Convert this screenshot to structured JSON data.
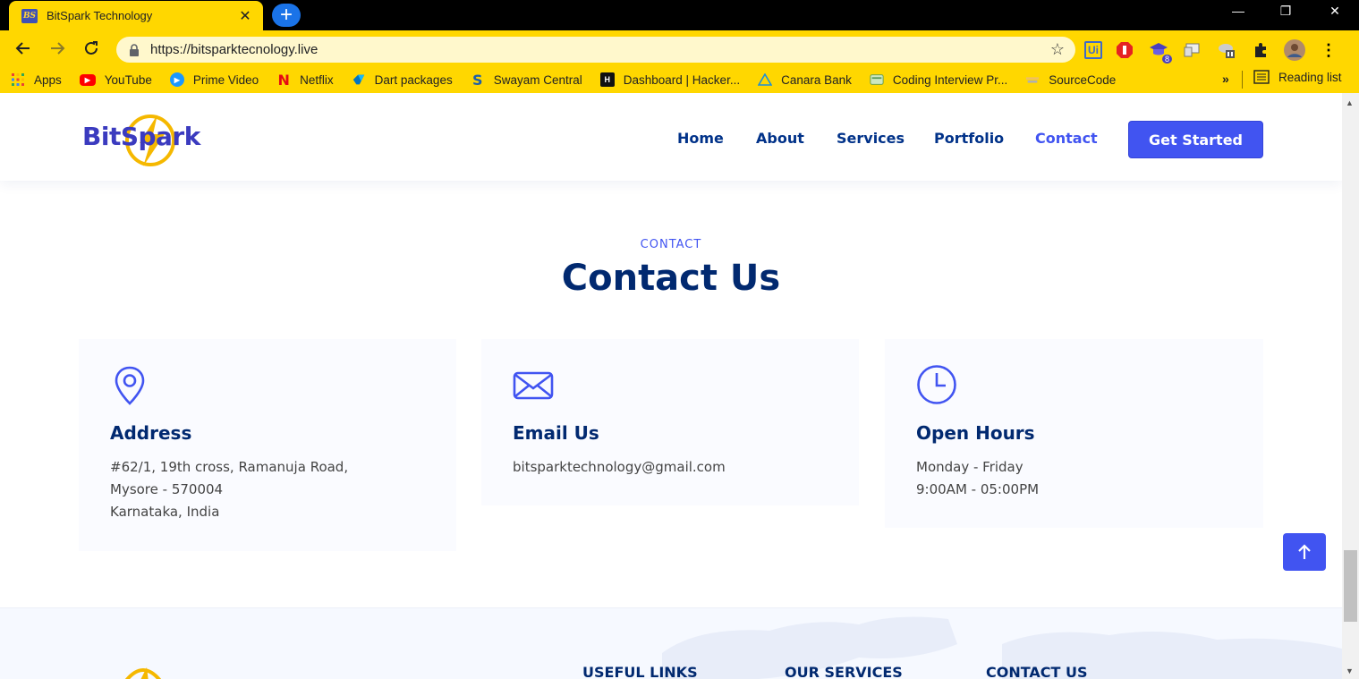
{
  "browser": {
    "tab": {
      "favicon": "BS",
      "title": "BitSpark Technology"
    },
    "url": "https://bitsparktecnology.live",
    "bookmarks": [
      {
        "label": "Apps",
        "icon": "apps-grid-icon"
      },
      {
        "label": "YouTube",
        "icon": "youtube-icon"
      },
      {
        "label": "Prime Video",
        "icon": "prime-video-icon"
      },
      {
        "label": "Netflix",
        "icon": "netflix-icon"
      },
      {
        "label": "Dart packages",
        "icon": "dart-icon"
      },
      {
        "label": "Swayam Central",
        "icon": "swayam-icon"
      },
      {
        "label": "Dashboard | Hacker...",
        "icon": "hackerearth-icon"
      },
      {
        "label": "Canara Bank",
        "icon": "canara-bank-icon"
      },
      {
        "label": "Coding Interview Pr...",
        "icon": "coding-interview-icon"
      },
      {
        "label": "SourceCode",
        "icon": "sourcecode-icon"
      }
    ],
    "more_bookmarks": "»",
    "reading_list": "Reading list",
    "extension_badge": "8"
  },
  "site": {
    "logo": "BitSpark",
    "nav": [
      "Home",
      "About",
      "Services",
      "Portfolio",
      "Contact"
    ],
    "cta": "Get Started"
  },
  "contact": {
    "subtitle": "CONTACT",
    "title": "Contact Us",
    "cards": [
      {
        "icon": "location-pin-icon",
        "title": "Address",
        "lines": [
          "#62/1, 19th cross, Ramanuja Road,",
          "Mysore - 570004",
          "Karnataka, India"
        ]
      },
      {
        "icon": "envelope-icon",
        "title": "Email Us",
        "lines": [
          "bitsparktechnology@gmail.com"
        ]
      },
      {
        "icon": "clock-icon",
        "title": "Open Hours",
        "lines": [
          "Monday - Friday",
          "9:00AM - 05:00PM"
        ]
      }
    ]
  },
  "footer": {
    "headings": [
      "USEFUL LINKS",
      "OUR SERVICES",
      "CONTACT US"
    ]
  },
  "colors": {
    "accent": "#4154f1",
    "heading": "#012970",
    "chrome": "#ffd700"
  }
}
